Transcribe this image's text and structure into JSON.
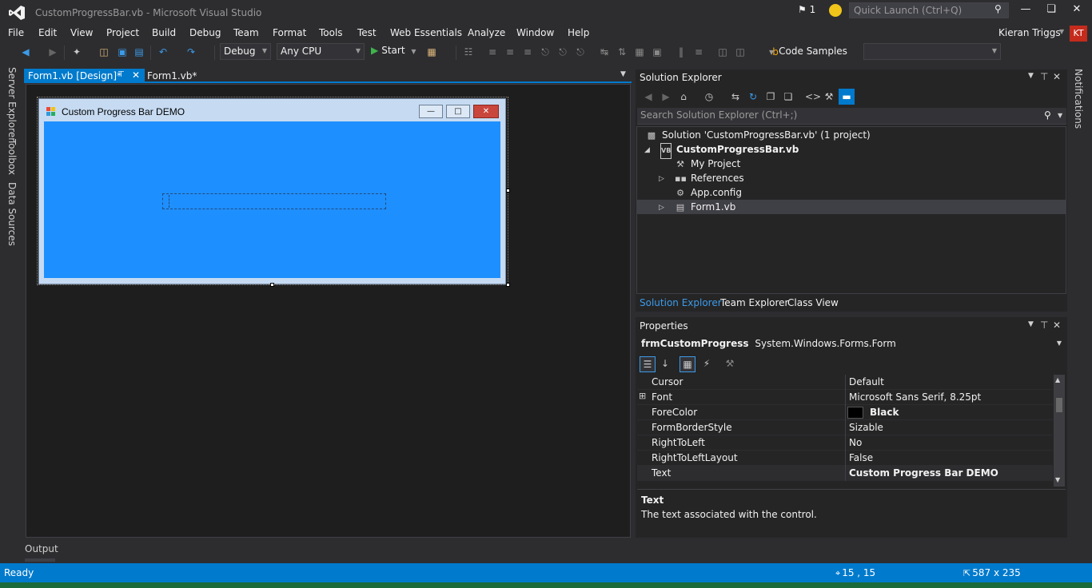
{
  "window": {
    "title": "CustomProgressBar.vb - Microsoft Visual Studio",
    "notification_count": "1",
    "quick_launch_placeholder": "Quick Launch (Ctrl+Q)",
    "user_name": "Kieran Triggs",
    "user_initials": "KT"
  },
  "menu": [
    "File",
    "Edit",
    "View",
    "Project",
    "Build",
    "Debug",
    "Team",
    "Format",
    "Tools",
    "Test",
    "Web Essentials",
    "Analyze",
    "Window",
    "Help"
  ],
  "toolbar": {
    "configuration": "Debug",
    "platform": "Any CPU",
    "start_label": "Start",
    "code_samples_label": "Code Samples"
  },
  "left_tabs": [
    "Server Explorer",
    "Toolbox",
    "Data Sources"
  ],
  "doc_tabs": {
    "active": "Form1.vb [Design]*",
    "inactive": "Form1.vb*"
  },
  "designer": {
    "form_title": "Custom Progress Bar DEMO",
    "form_back_color": "#1e8fff"
  },
  "solution_explorer": {
    "title": "Solution Explorer",
    "search_placeholder": "Search Solution Explorer (Ctrl+;)",
    "tree": {
      "solution": "Solution 'CustomProgressBar.vb' (1 project)",
      "project": "CustomProgressBar.vb",
      "my_project": "My Project",
      "references": "References",
      "app_config": "App.config",
      "form1": "Form1.vb"
    },
    "bottom_tabs": [
      "Solution Explorer",
      "Team Explorer",
      "Class View"
    ]
  },
  "properties": {
    "title": "Properties",
    "object_name": "frmCustomProgress",
    "object_type": "System.Windows.Forms.Form",
    "rows": [
      {
        "name": "Cursor",
        "value": "Default"
      },
      {
        "name": "Font",
        "value": "Microsoft Sans Serif, 8.25pt"
      },
      {
        "name": "ForeColor",
        "value": "Black"
      },
      {
        "name": "FormBorderStyle",
        "value": "Sizable"
      },
      {
        "name": "RightToLeft",
        "value": "No"
      },
      {
        "name": "RightToLeftLayout",
        "value": "False"
      },
      {
        "name": "Text",
        "value": "Custom Progress Bar DEMO"
      }
    ],
    "description_title": "Text",
    "description_text": "The text associated with the control."
  },
  "notifications_label": "Notifications",
  "output_label": "Output",
  "status": {
    "ready": "Ready",
    "position": "15 , 15",
    "size": "587 x 235"
  },
  "colors": {
    "accent": "#007acc",
    "background": "#2d2d30",
    "form_client": "#1e8fff"
  }
}
